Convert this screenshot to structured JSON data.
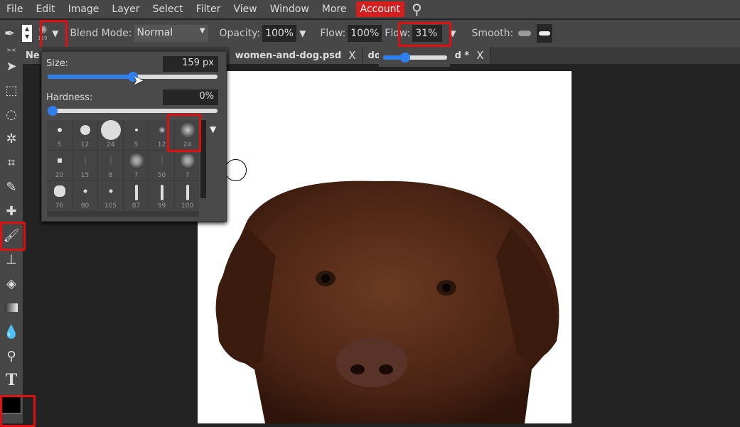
{
  "menu": [
    "File",
    "Edit",
    "Image",
    "Layer",
    "Select",
    "Filter",
    "View",
    "Window",
    "More",
    "Account"
  ],
  "options": {
    "brush_size_preview": "159",
    "blend_label": "Blend Mode:",
    "blend_value": "Normal",
    "opacity_label": "Opacity:",
    "opacity_value": "100%",
    "flow_label": "Flow:",
    "flow_value": "100%",
    "flow2_label": "Flow:",
    "flow2_value": "31%",
    "flow2_slider": 0.31,
    "smooth_label": "Smooth:"
  },
  "tabs": [
    {
      "label": "Ne"
    },
    {
      "label": "women-and-dog.psd",
      "close": "X"
    },
    {
      "label": "dog",
      "close": "X",
      "suffix": "d *"
    }
  ],
  "brush_panel": {
    "size_label": "Size:",
    "size_value": "159 px",
    "size_fraction": 0.5,
    "hardness_label": "Hardness:",
    "hardness_value": "0%",
    "hardness_fraction": 0,
    "presets": [
      "5",
      "12",
      "24",
      "5",
      "12",
      "24",
      "20",
      "15",
      "8",
      "7",
      "50",
      "7",
      "76",
      "80",
      "105",
      "87",
      "99",
      "100"
    ],
    "selected_preset_index": 5
  },
  "colors": {
    "accent": "#2f80ed",
    "highlight": "#e01010",
    "account": "#d41f1f"
  }
}
